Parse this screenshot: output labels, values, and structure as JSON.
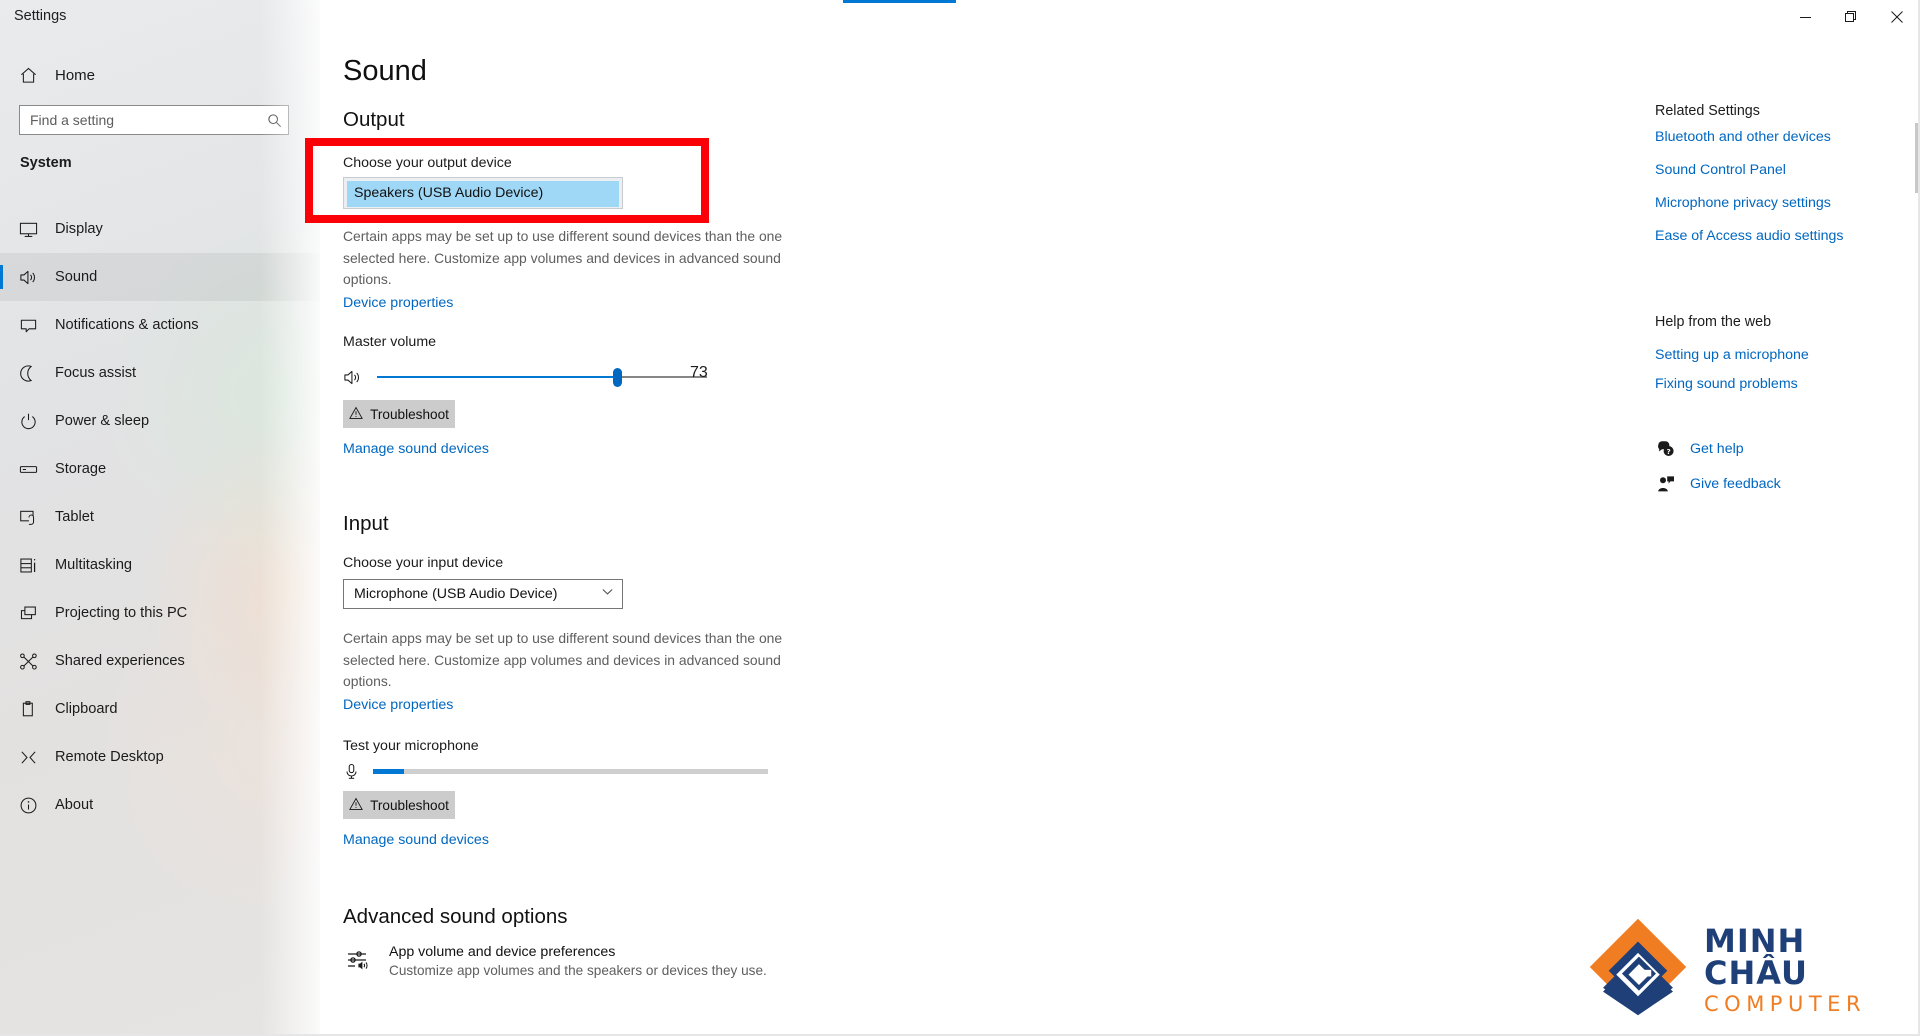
{
  "window": {
    "title": "Settings",
    "minimize_label": "Minimize",
    "maximize_label": "Restore",
    "close_label": "Close"
  },
  "sidebar": {
    "home_label": "Home",
    "home_icon": "home-icon",
    "search": {
      "placeholder": "Find a setting",
      "value": "",
      "icon": "search-icon"
    },
    "group_title": "System",
    "items": [
      {
        "label": "Display",
        "icon": "monitor-icon",
        "selected": false
      },
      {
        "label": "Sound",
        "icon": "speaker-icon",
        "selected": true
      },
      {
        "label": "Notifications & actions",
        "icon": "notification-icon",
        "selected": false
      },
      {
        "label": "Focus assist",
        "icon": "moon-icon",
        "selected": false
      },
      {
        "label": "Power & sleep",
        "icon": "power-icon",
        "selected": false
      },
      {
        "label": "Storage",
        "icon": "storage-icon",
        "selected": false
      },
      {
        "label": "Tablet",
        "icon": "tablet-icon",
        "selected": false
      },
      {
        "label": "Multitasking",
        "icon": "multitasking-icon",
        "selected": false
      },
      {
        "label": "Projecting to this PC",
        "icon": "projecting-icon",
        "selected": false
      },
      {
        "label": "Shared experiences",
        "icon": "shared-icon",
        "selected": false
      },
      {
        "label": "Clipboard",
        "icon": "clipboard-icon",
        "selected": false
      },
      {
        "label": "Remote Desktop",
        "icon": "remote-desktop-icon",
        "selected": false
      },
      {
        "label": "About",
        "icon": "info-icon",
        "selected": false
      }
    ]
  },
  "main": {
    "page_title": "Sound",
    "output": {
      "section_title": "Output",
      "choose_label": "Choose your output device",
      "device_value": "Speakers (USB Audio Device)",
      "description": "Certain apps may be set up to use different sound devices than the one selected here. Customize app volumes and devices in advanced sound options.",
      "device_properties_link": "Device properties",
      "master_volume_label": "Master volume",
      "volume_value": "73",
      "volume_percent": 73,
      "speaker_icon": "speaker-volume-icon",
      "troubleshoot_label": "Troubleshoot",
      "troubleshoot_icon": "warning-triangle-icon",
      "manage_link": "Manage sound devices"
    },
    "input": {
      "section_title": "Input",
      "choose_label": "Choose your input device",
      "device_value": "Microphone (USB Audio Device)",
      "dropdown_icon": "chevron-down-icon",
      "description": "Certain apps may be set up to use different sound devices than the one selected here. Customize app volumes and devices in advanced sound options.",
      "device_properties_link": "Device properties",
      "test_label": "Test your microphone",
      "mic_icon": "microphone-icon",
      "mic_level_percent": 8,
      "troubleshoot_label": "Troubleshoot",
      "troubleshoot_icon": "warning-triangle-icon",
      "manage_link": "Manage sound devices"
    },
    "advanced": {
      "section_title": "Advanced sound options",
      "item_icon": "mixer-icon",
      "item_title": "App volume and device preferences",
      "item_subtitle": "Customize app volumes and the speakers or devices they use."
    }
  },
  "right_pane": {
    "related_title": "Related Settings",
    "related_links": [
      "Bluetooth and other devices",
      "Sound Control Panel",
      "Microphone privacy settings",
      "Ease of Access audio settings"
    ],
    "help_title": "Help from the web",
    "help_links": [
      "Setting up a microphone",
      "Fixing sound problems"
    ],
    "actions": [
      {
        "label": "Get help",
        "icon": "help-chat-icon"
      },
      {
        "label": "Give feedback",
        "icon": "feedback-person-icon"
      }
    ]
  },
  "watermark": {
    "brand_main": "MINH CHÂU",
    "brand_sub": "COMPUTER",
    "logo_icon": "minh-chau-diamond-logo",
    "color_orange": "#f07d22",
    "color_navy": "#1f3f78"
  },
  "theme": {
    "accent": "#0078d4",
    "link": "#0067c0",
    "highlight_box": "#fb0007",
    "selection_blue": "#9fd7f7"
  }
}
